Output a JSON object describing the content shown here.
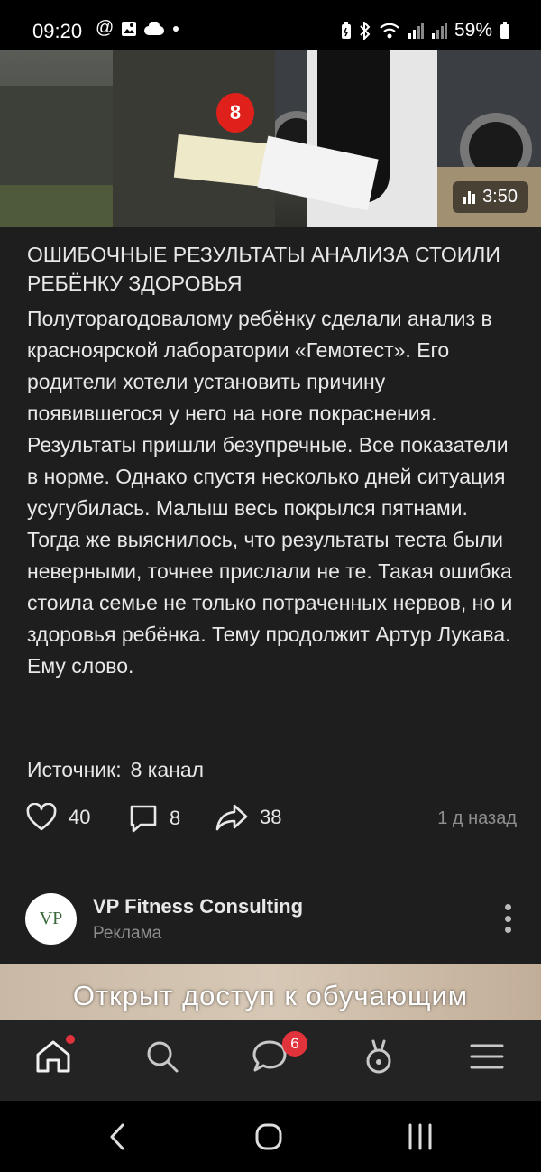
{
  "status_bar": {
    "time": "09:20",
    "battery": "59%",
    "icons": [
      "at-icon",
      "gallery-icon",
      "cloud-icon",
      "dot-icon",
      "battery-saver-icon",
      "bluetooth-icon",
      "wifi-icon",
      "signal-icon",
      "signal-icon",
      "battery-icon"
    ]
  },
  "video": {
    "duration": "3:50",
    "mic_logo": "8"
  },
  "post": {
    "title": "ОШИБОЧНЫЕ РЕЗУЛЬТАТЫ АНАЛИЗА СТОИЛИ РЕБЁНКУ ЗДОРОВЬЯ",
    "body": "Полуторагодовалому ребёнку сделали анализ в красноярской лаборатории «Гемотест». Его родители хотели установить причину появившегося у него на ноге покраснения. Результаты пришли безупречные. Все показатели в норме. Однако спустя несколько дней ситуация усугубилась. Малыш весь покрылся пятнами. Тогда же выяснилось, что результаты теста были неверными, точнее прислали не те. Такая ошибка стоила семье не только потраченных нервов, но и здоровья ребёнка. Тему продолжит Артур Лукава. Ему слово.",
    "source_label": "Источник:",
    "source_value": "8 канал",
    "likes": "40",
    "comments": "8",
    "shares": "38",
    "time_ago": "1 д назад"
  },
  "ad": {
    "avatar_text": "VP",
    "name": "VP Fitness Consulting",
    "label": "Реклама",
    "banner_text": "Открыт доступ к обучающим"
  },
  "bottom_nav": {
    "messages_badge": "6",
    "items": [
      "home-icon",
      "search-icon",
      "messages-icon",
      "clips-icon",
      "menu-icon"
    ]
  },
  "colors": {
    "background": "#1e1e1e",
    "text": "#e8e8e8",
    "muted": "#8e8e8e",
    "badge": "#e1333c"
  }
}
